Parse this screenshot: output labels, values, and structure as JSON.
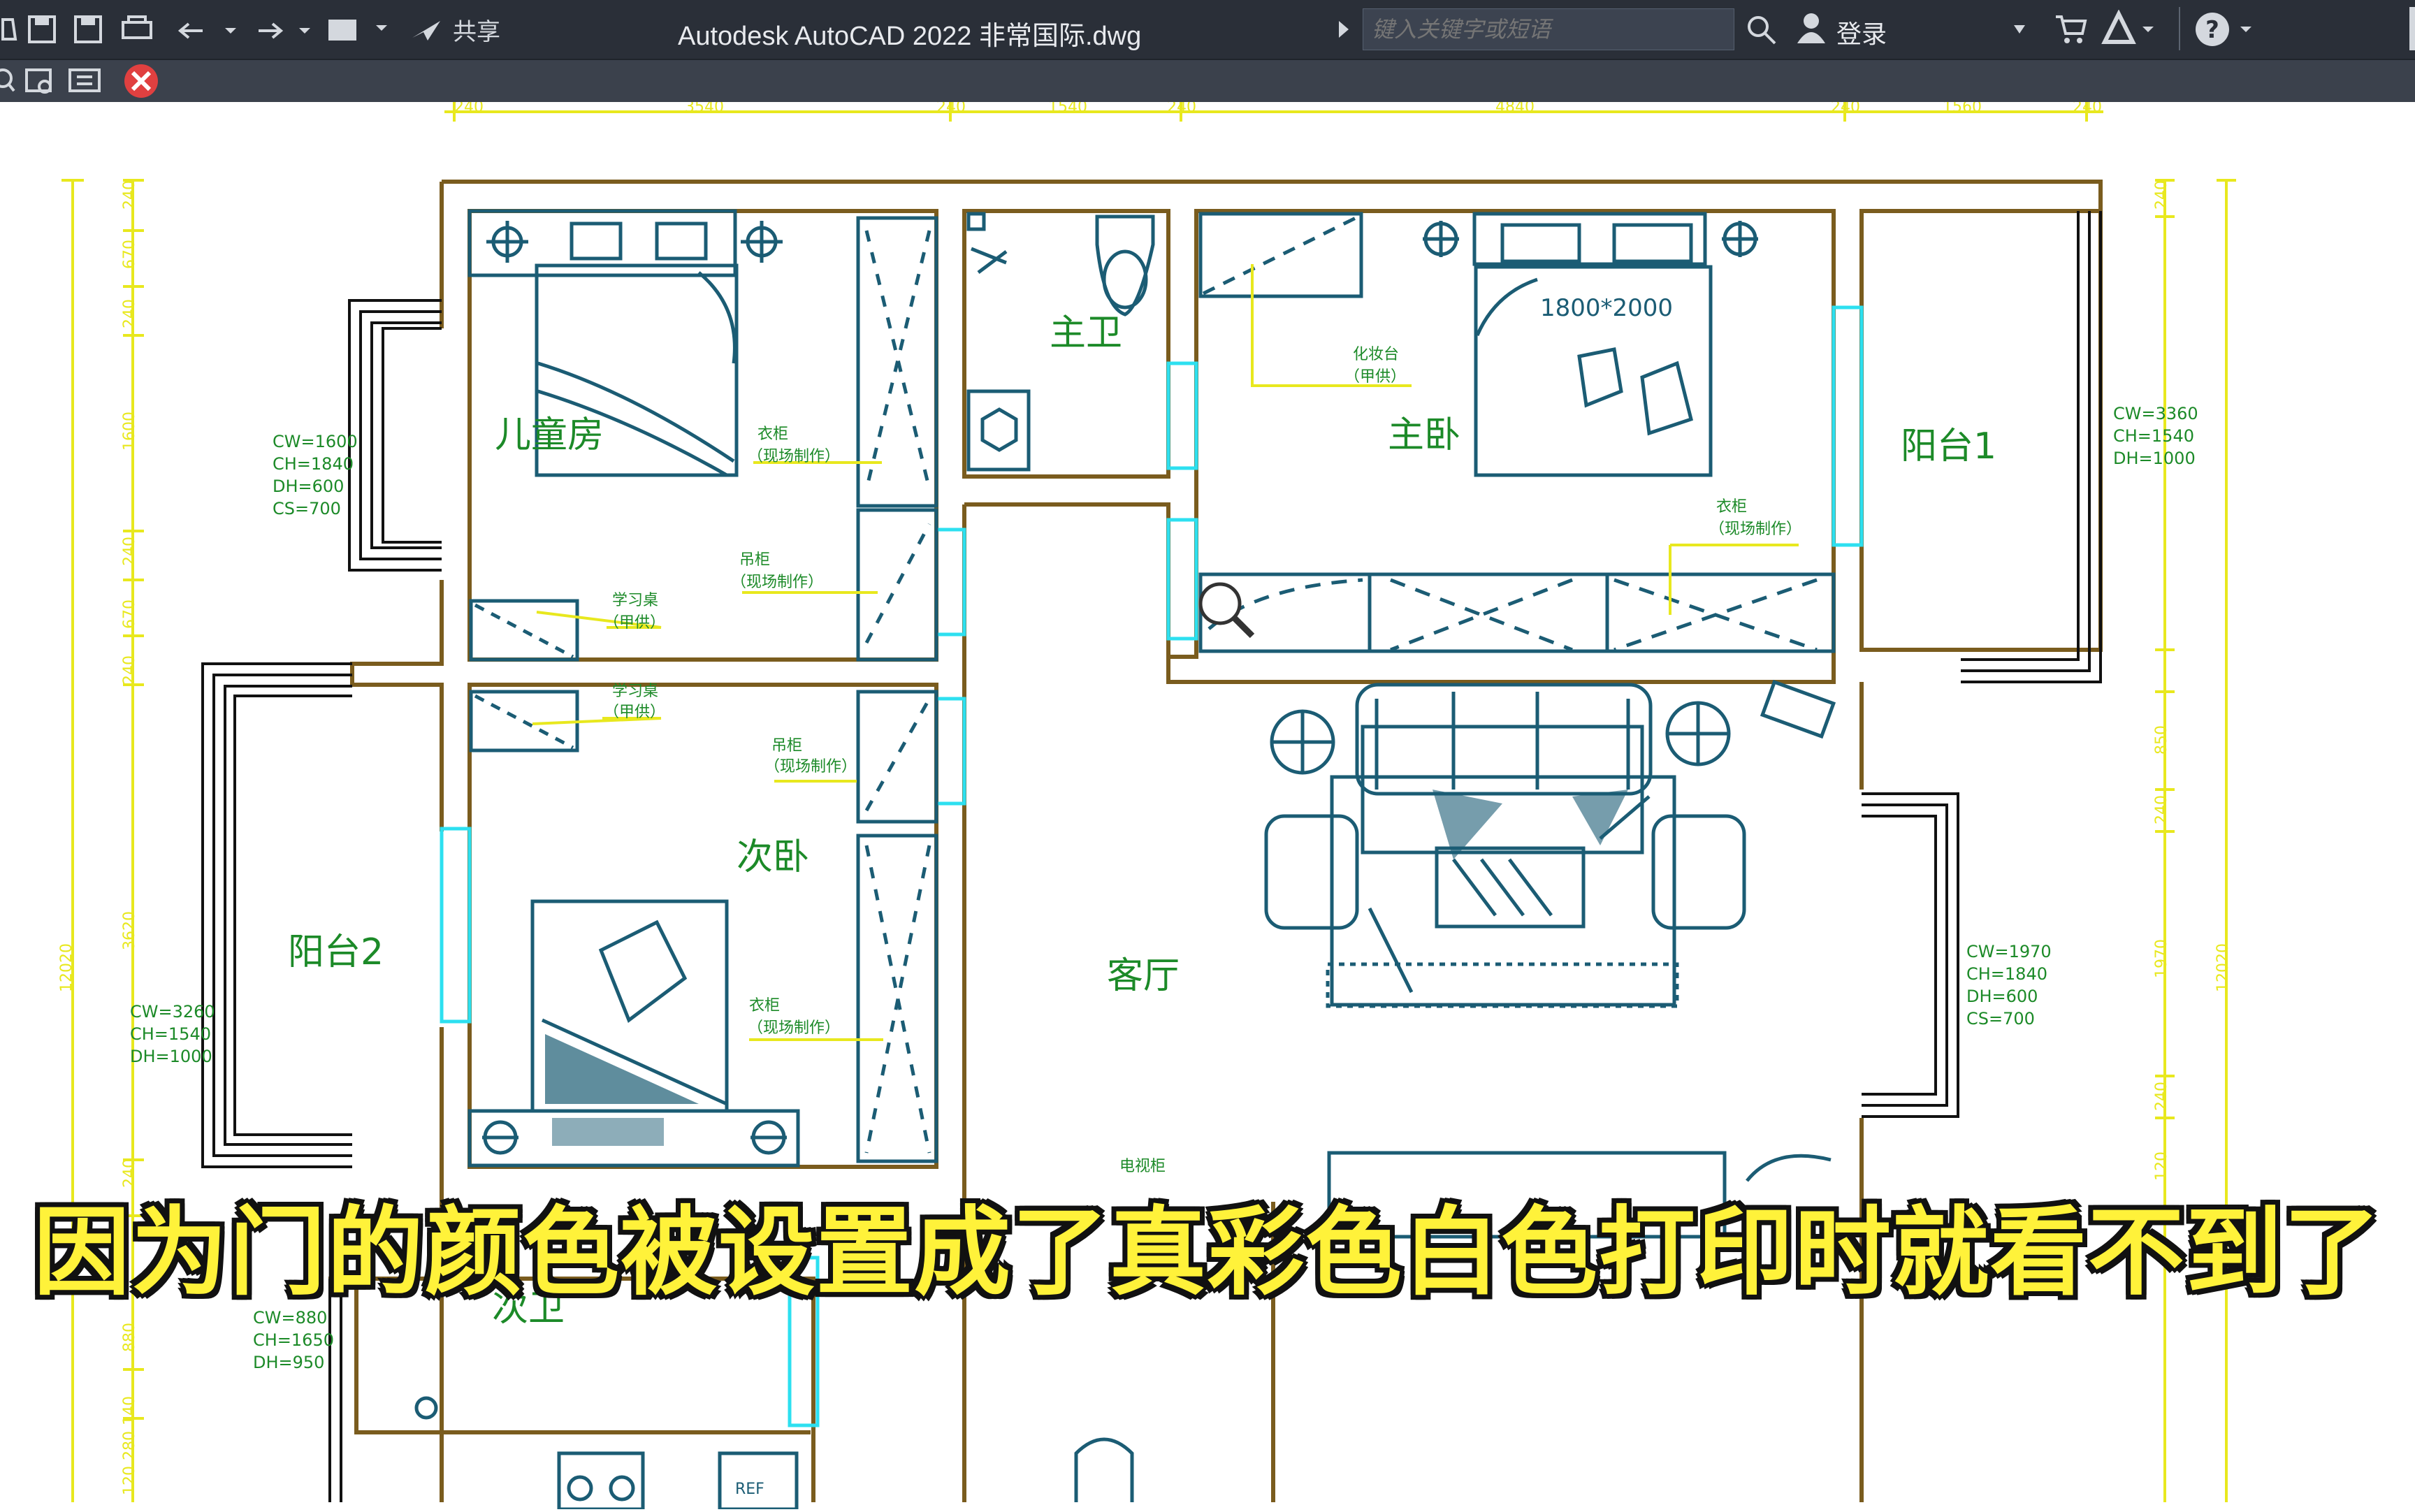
{
  "window": {
    "title": "Autodesk AutoCAD 2022    非常国际.dwg",
    "share_label": "共享",
    "search_placeholder": "键入关键字或短语",
    "login_label": "登录",
    "help_label": "?"
  },
  "colors": {
    "wall": "#7a5c1e",
    "furniture": "#1b5c74",
    "window": "#2de0f0",
    "dimension": "#e8e81e",
    "text": "#1c8a28",
    "annotation_green": "#1c8a28",
    "subtitle": "#fff23a"
  },
  "dimensions": {
    "top": [
      "240",
      "3540",
      "240",
      "1540",
      "240",
      "4840",
      "240",
      "1560",
      "240"
    ],
    "left": [
      "240",
      "670",
      "240",
      "1600",
      "240",
      "670",
      "240",
      "3620",
      "240",
      "880",
      "140",
      "280",
      "120"
    ],
    "left_total": "12020",
    "right": [
      "240",
      "850",
      "240",
      "1970",
      "240",
      "120"
    ],
    "right_total": "12020"
  },
  "rooms": {
    "kids_room": "儿童房",
    "master_bath": "主卫",
    "master_bedroom": "主卧",
    "balcony1": "阳台1",
    "balcony2": "阳台2",
    "second_bedroom": "次卧",
    "living_room": "客厅",
    "second_bath": "次卫"
  },
  "annotations": {
    "bed_size": "1800*2000",
    "wardrobe": "衣柜",
    "onsite_made": "（现场制作）",
    "hanging_cabinet": "吊柜",
    "study_desk": "学习桌",
    "owner_supplied": "（甲供）",
    "dresser": "化妆台",
    "tv_cabinet": "电视柜",
    "ref": "REF"
  },
  "window_specs": {
    "kids": [
      "CW=1600",
      "CH=1840",
      "DH=600",
      "CS=700"
    ],
    "balcony1": [
      "CW=3360",
      "CH=1540",
      "DH=1000"
    ],
    "balcony2": [
      "CW=3260",
      "CH=1540",
      "DH=1000"
    ],
    "living": [
      "CW=1970",
      "CH=1840",
      "DH=600",
      "CS=700"
    ],
    "bath": [
      "CW=880",
      "CH=1650",
      "DH=950"
    ]
  },
  "subtitle": "因为门的颜色被设置成了真彩色白色打印时就看不到了"
}
